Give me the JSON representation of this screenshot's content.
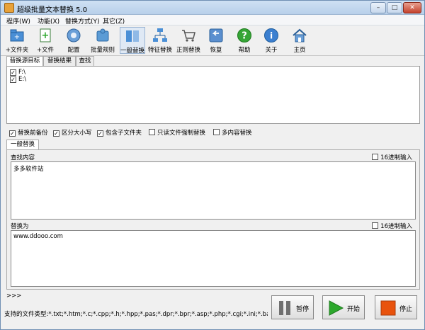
{
  "window": {
    "title": "超级批量文本替换 5.0",
    "min_glyph": "–",
    "max_glyph": "□",
    "close_glyph": "✕"
  },
  "menu": [
    "程序(W)",
    "功能(X)",
    "替换方式(Y)",
    "其它(Z)"
  ],
  "toolbar": [
    {
      "label": "+文件夹",
      "icon": "folder-plus-icon"
    },
    {
      "label": "+文件",
      "icon": "file-plus-icon"
    },
    {
      "label": "配置",
      "icon": "config-icon"
    },
    {
      "label": "批量规则",
      "icon": "puzzle-icon"
    },
    {
      "label": "一般替换",
      "icon": "replace-icon",
      "active": true
    },
    {
      "label": "特征替换",
      "icon": "tree-icon"
    },
    {
      "label": "正则替换",
      "icon": "cart-icon"
    },
    {
      "label": "恢复",
      "icon": "restore-icon"
    },
    {
      "label": "帮助",
      "icon": "help-icon"
    },
    {
      "label": "关于",
      "icon": "info-icon"
    },
    {
      "label": "主页",
      "icon": "home-icon"
    }
  ],
  "source_tabs": [
    "替换源目标",
    "替换结果",
    "查找"
  ],
  "drives": [
    {
      "label": "F:\\",
      "checked": true
    },
    {
      "label": "E:\\",
      "checked": true
    }
  ],
  "options": [
    {
      "label": "替换前备份",
      "checked": true
    },
    {
      "label": "区分大小写",
      "checked": true
    },
    {
      "label": "包含子文件夹",
      "checked": true
    },
    {
      "label": "只读文件强制替换",
      "checked": false
    },
    {
      "label": "多内容替换",
      "checked": false
    }
  ],
  "replace_tab": "一般替换",
  "find": {
    "label": "查找内容",
    "value": "多多软件站",
    "hex_label": "16进制输入",
    "hex_checked": false
  },
  "replace": {
    "label": "替换为",
    "value": "www.ddooo.com",
    "hex_label": "16进制输入",
    "hex_checked": false
  },
  "status_prompt": ">>>",
  "filetypes": "支持的文件类型:*.txt;*.htm;*.c;*.cpp;*.h;*.hpp;*.pas;*.dpr;*.bpr;*.asp;*.php;*.cgi;*.ini;*.bat;*.inc;*.java;*.py;*.dfm",
  "buttons": {
    "pause": "暂停",
    "start": "开始",
    "stop": "停止"
  },
  "colors": {
    "start_green": "#2da82d",
    "stop_orange": "#e8520c",
    "pause_gray": "#707070",
    "accent_blue": "#2a6fb5"
  }
}
